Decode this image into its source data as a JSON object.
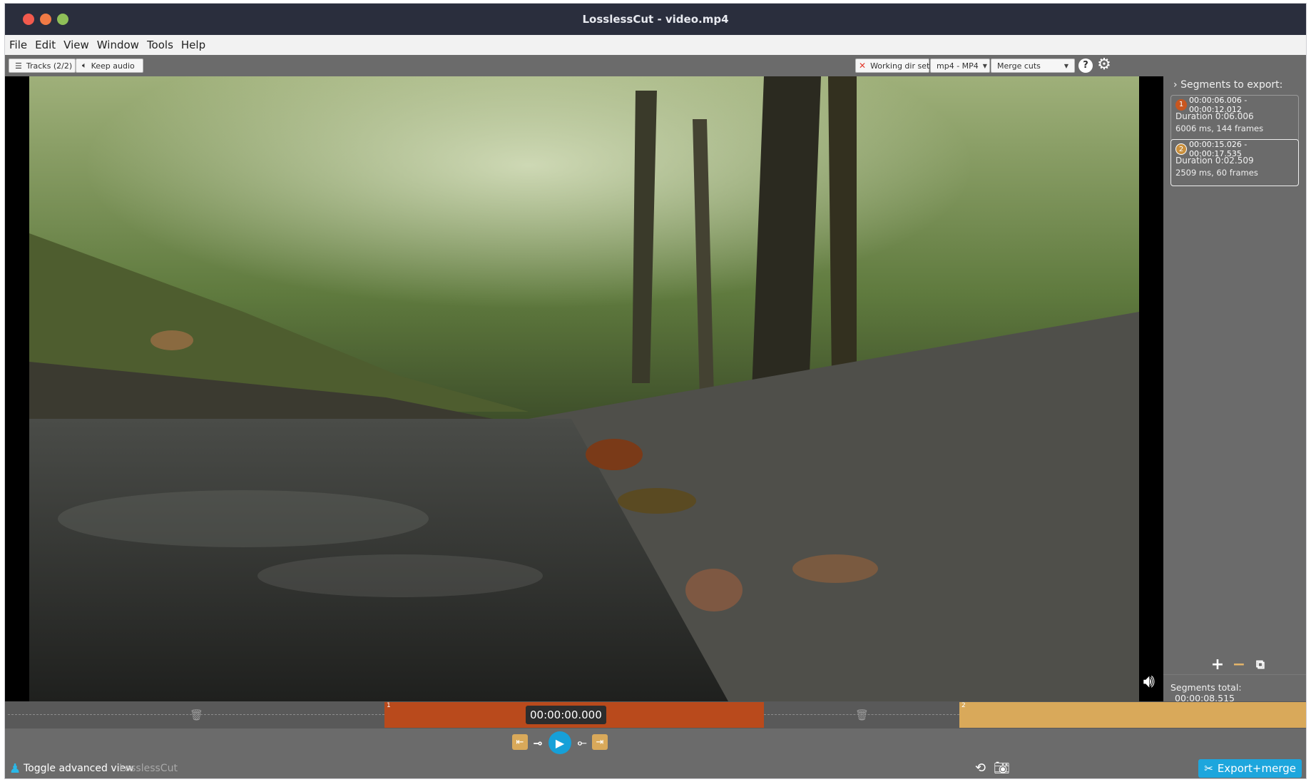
{
  "window": {
    "title": "LosslessCut - video.mp4"
  },
  "menu": {
    "items": [
      "File",
      "Edit",
      "View",
      "Window",
      "Tools",
      "Help"
    ]
  },
  "toolbar": {
    "tracks_label": "Tracks (2/2)",
    "keep_audio_label": "Keep audio",
    "working_dir_label": "Working dir set",
    "format_value": "mp4 - MP4",
    "cut_mode_value": "Merge cuts",
    "help_glyph": "?"
  },
  "sidebar": {
    "heading": "Segments to export:",
    "segments": [
      {
        "number": "1",
        "range": "00:00:06.006 - 00:00:12.012",
        "duration": "Duration 0:06.006",
        "detail": "6006 ms, 144 frames",
        "color": "#c9561f"
      },
      {
        "number": "2",
        "range": "00:00:15.026 - 00:00:17.535",
        "duration": "Duration 0:02.509",
        "detail": "2509 ms, 60 frames",
        "color": "#c98f3c"
      }
    ],
    "total_label": "Segments total:",
    "total_value": "00:00:08.515"
  },
  "timeline": {
    "current_time": "00:00:00.000",
    "segments": [
      {
        "label": "1",
        "color": "#b94a1c",
        "start_fraction": 0.293,
        "end_fraction": 0.585
      },
      {
        "label": "2",
        "color": "#d9a95a",
        "start_fraction": 0.733,
        "end_fraction": 1.0
      }
    ]
  },
  "bottom": {
    "toggle_label": "Toggle advanced view",
    "brand": "LosslessCut",
    "export_label": "Export+merge"
  },
  "colors": {
    "accent": "#1da6dd",
    "segment1": "#b94a1c",
    "segment2": "#d9a95a",
    "titlebar": "#2a2e3d"
  }
}
